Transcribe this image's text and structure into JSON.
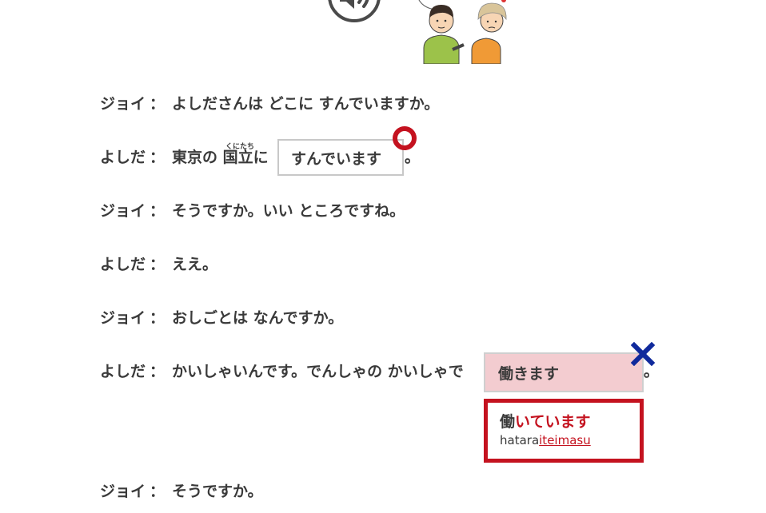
{
  "colors": {
    "text": "#3a3a3a",
    "correct_mark": "#c4121f",
    "wrong_mark": "#102a9c",
    "wrong_bg": "#f3ccd0"
  },
  "icons": {
    "audio": "speaker-icon",
    "illustration": "two-people-illustration",
    "correct": "circle-mark-icon",
    "wrong": "cross-mark-icon"
  },
  "dialogue": [
    {
      "speaker": "ジョイ",
      "colon": "：",
      "text": "よしださんは どこに すんでいますか。"
    },
    {
      "speaker": "よしだ",
      "colon": "：",
      "text_before": "東京の ",
      "kanji": "国立",
      "ruby": "くにたち",
      "text_mid": "に",
      "answer": "すんでいます",
      "text_after": "。"
    },
    {
      "speaker": "ジョイ",
      "colon": "：",
      "text": "そうですか。いい ところですね。"
    },
    {
      "speaker": "よしだ",
      "colon": "：",
      "text": "ええ。"
    },
    {
      "speaker": "ジョイ",
      "colon": "：",
      "text": "おしごとは なんですか。"
    },
    {
      "speaker": "よしだ",
      "colon": "：",
      "text_before": "かいしゃいんです。でんしゃの かいしゃで",
      "answer": "働きます",
      "text_after": "。",
      "correction_prefix": "働",
      "correction_highlight": "いています",
      "romaji_prefix": "hatara",
      "romaji_highlight": "iteimasu"
    },
    {
      "speaker": "ジョイ",
      "colon": "：",
      "text": "そうですか。"
    }
  ]
}
